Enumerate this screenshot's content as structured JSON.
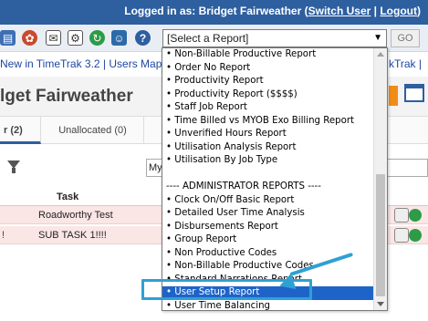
{
  "topbar": {
    "logged_in_prefix": "Logged in as: Bridget Fairweather (",
    "switch_user": "Switch User",
    "separator": " | ",
    "logout": "Logout",
    "suffix": ")"
  },
  "toolbar": {
    "icons": [
      "report-icon",
      "network-icon",
      "email-icon",
      "settings-icon",
      "refresh-icon",
      "users-icon",
      "help-icon"
    ],
    "report_select_value": "[Select a Report]",
    "go_label": "GO"
  },
  "newsbar": {
    "left_text": "New in TimeTrak 3.2 | Users Map",
    "right_text": "kTrak |"
  },
  "header": {
    "title": "lget Fairweather"
  },
  "tabs": {
    "active_label": "r (2)",
    "unallocated_label": "Unallocated (0)"
  },
  "filters": {
    "my_select_value": "My"
  },
  "grid": {
    "task_header": "Task",
    "rows": [
      {
        "lead": "",
        "task": "Roadworthy Test"
      },
      {
        "lead": "!",
        "task": "SUB TASK 1!!!!"
      }
    ]
  },
  "dropdown": {
    "items": [
      "• Non-Billable Productive Report",
      "• Order No Report",
      "• Productivity Report",
      "• Productivity Report ($$$$)",
      "• Staff Job Report",
      "• Time Billed vs MYOB Exo Billing Report",
      "• Unverified Hours Report",
      "• Utilisation Analysis Report",
      "• Utilisation By Job Type",
      "",
      "---- ADMINISTRATOR REPORTS ----",
      "• Clock On/Off Basic Report",
      "• Detailed User Time Analysis",
      "• Disbursements Report",
      "• Group Report",
      "• Non Productive Codes",
      "• Non-Billable Productive Codes",
      "• Standard Narrations Report",
      "• User Setup Report",
      "• User Time Balancing"
    ],
    "selected_index": 18
  },
  "colors": {
    "topbar": "#2e5f9f",
    "selection": "#1e64c8",
    "highlight": "#2fa0d4",
    "row_bg": "#fbe6e6"
  }
}
